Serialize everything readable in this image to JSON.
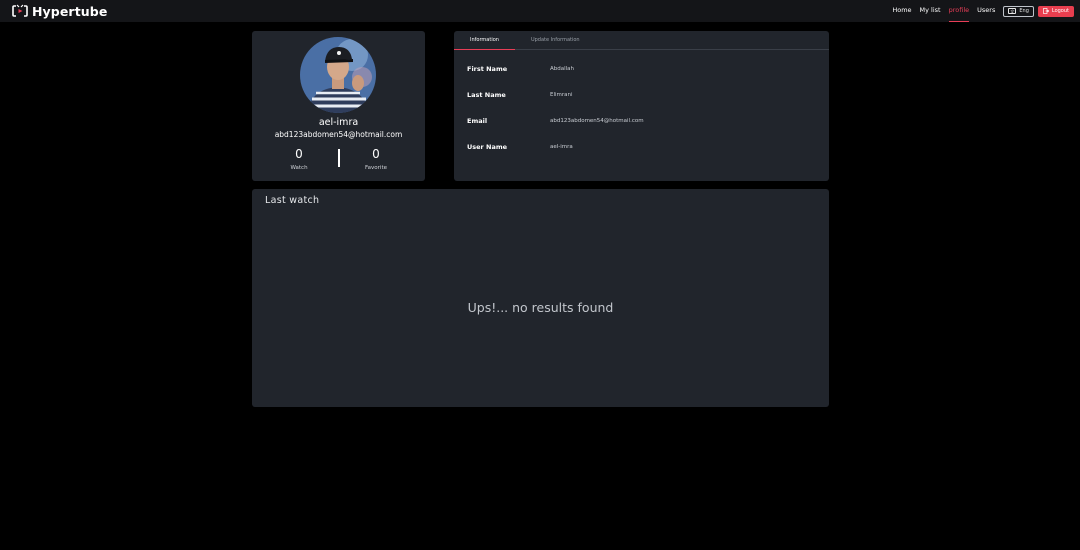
{
  "brand": {
    "name": "Hypertube",
    "icon": "hypertube-logo-icon"
  },
  "nav": {
    "links": [
      {
        "label": "Home",
        "active": false
      },
      {
        "label": "My list",
        "active": false
      },
      {
        "label": "profile",
        "active": true
      },
      {
        "label": "Users",
        "active": false
      }
    ],
    "lang_label": "Eng",
    "lang_icon": "translate-icon",
    "logout_label": "Logout",
    "logout_icon": "logout-icon"
  },
  "profile": {
    "username": "ael-imra",
    "email": "abd123abdomen54@hotmail.com",
    "stats": [
      {
        "value": "0",
        "label": "Watch"
      },
      {
        "value": "0",
        "label": "Favorite"
      }
    ]
  },
  "info": {
    "tabs": [
      {
        "label": "Information",
        "active": true
      },
      {
        "label": "Update Information",
        "active": false
      }
    ],
    "rows": [
      {
        "label": "First Name",
        "value": "Abdallah"
      },
      {
        "label": "Last Name",
        "value": "Elimrani"
      },
      {
        "label": "Email",
        "value": "abd123abdomen54@hotmail.com"
      },
      {
        "label": "User Name",
        "value": "ael-imra"
      }
    ]
  },
  "last_watch": {
    "title": "Last watch",
    "empty_message": "Ups!... no results found"
  },
  "colors": {
    "accent": "#e83e57",
    "card_bg": "#21252c",
    "navbar_bg": "#141518",
    "page_bg": "#000000"
  }
}
